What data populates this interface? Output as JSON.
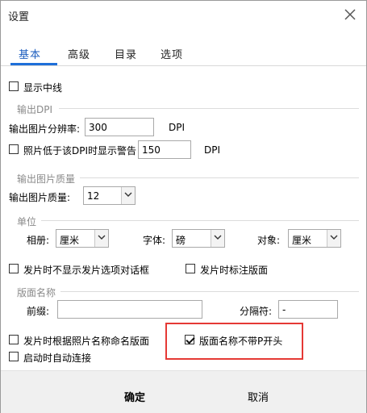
{
  "window": {
    "title": "设置"
  },
  "tabs": [
    {
      "label": "基本",
      "active": true
    },
    {
      "label": "高级",
      "active": false
    },
    {
      "label": "目录",
      "active": false
    },
    {
      "label": "选项",
      "active": false
    }
  ],
  "show_center_line": {
    "label": "显示中线",
    "checked": false
  },
  "output_dpi": {
    "group_label": "输出DPI",
    "resolution_label": "输出图片分辨率:",
    "resolution_value": "300",
    "resolution_unit": "DPI",
    "warn_label": "照片低于该DPI时显示警告",
    "warn_checked": false,
    "warn_value": "150",
    "warn_unit": "DPI"
  },
  "output_quality": {
    "group_label": "输出图片质量",
    "label": "输出图片质量:",
    "value": "12"
  },
  "unit": {
    "group_label": "单位",
    "album_label": "相册:",
    "album_value": "厘米",
    "font_label": "字体:",
    "font_value": "磅",
    "object_label": "对象:",
    "object_value": "厘米"
  },
  "options": {
    "no_dialog_label": "发片时不显示发片选项对话框",
    "no_dialog_checked": false,
    "mark_layout_label": "发片时标注版面",
    "mark_layout_checked": false
  },
  "layout_name": {
    "group_label": "版面名称",
    "prefix_label": "前缀:",
    "prefix_value": "",
    "separator_label": "分隔符:",
    "separator_value": "-"
  },
  "bottom_options": {
    "name_by_photo_label": "发片时根据照片名称命名版面",
    "name_by_photo_checked": false,
    "no_p_prefix_label": "版面名称不带P开头",
    "no_p_prefix_checked": true,
    "auto_connect_label": "启动时自动连接",
    "auto_connect_checked": false
  },
  "footer": {
    "ok_label": "确定",
    "cancel_label": "取消"
  },
  "colors": {
    "accent": "#1e6fd9",
    "highlight_box": "#e53935"
  }
}
